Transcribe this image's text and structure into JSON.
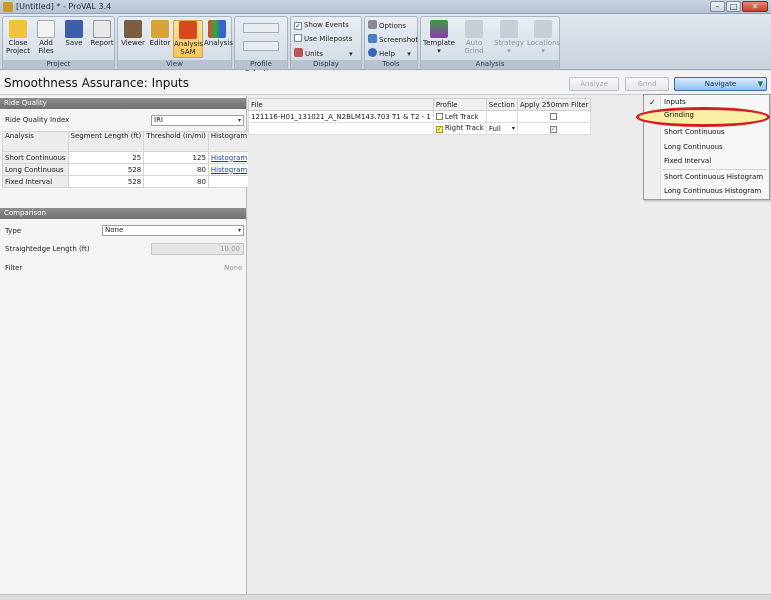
{
  "window": {
    "title": "[Untitled] * - ProVAL 3.4"
  },
  "ribbon": {
    "groups": {
      "project": {
        "label": "Project",
        "buttons": [
          "Close Project",
          "Add Files",
          "Save",
          "Report"
        ]
      },
      "view": {
        "label": "View",
        "buttons": [
          "Viewer",
          "Editor",
          "Analysis SAM",
          "Analysis"
        ]
      },
      "profile_selection": {
        "label": "Profile Selection"
      },
      "display": {
        "label": "Display",
        "items": [
          "Show Events",
          "Use Mileposts",
          "Units"
        ]
      },
      "tools": {
        "label": "Tools",
        "items": [
          "Options",
          "Screenshot",
          "Help"
        ]
      },
      "analysis": {
        "label": "Analysis",
        "buttons": [
          "Template",
          "Auto Grind",
          "Strategy",
          "Locations"
        ]
      }
    }
  },
  "header": {
    "title": "Smoothness Assurance: Inputs",
    "analyze_label": "Analyze",
    "grind_label": "Grind",
    "navigate_label": "Navigate"
  },
  "ride_quality": {
    "section_label": "Ride Quality",
    "index_label": "Ride Quality Index",
    "index_value": "IRI",
    "columns": [
      "Analysis",
      "Segment Length (ft)",
      "Threshold (in/mi)",
      "Histogram"
    ],
    "rows": [
      {
        "analysis": "Short Continuous",
        "segment": "25",
        "threshold": "125",
        "histogram": "Histogram"
      },
      {
        "analysis": "Long Continuous",
        "segment": "528",
        "threshold": "80",
        "histogram": "Histogram"
      },
      {
        "analysis": "Fixed Interval",
        "segment": "528",
        "threshold": "80",
        "histogram": ""
      }
    ]
  },
  "comparison": {
    "section_label": "Comparison",
    "type_label": "Type",
    "type_value": "None",
    "straightedge_label": "Straightedge Length (ft)",
    "straightedge_value": "10.00",
    "filter_label": "Filter",
    "filter_value": "None"
  },
  "files": {
    "columns": [
      "File",
      "Profile",
      "Section",
      "Apply 250mm Filter"
    ],
    "rows": [
      {
        "file": "121116-H01_131021_A_N2BLM143.703 T1 & T2 - 1",
        "profile": "Left Track",
        "profile_checked": false,
        "section": "",
        "filter_checked": false
      },
      {
        "file": "",
        "profile": "Right Track",
        "profile_checked": true,
        "section": "Full",
        "filter_checked": true
      }
    ]
  },
  "navigate_menu": {
    "items": [
      "Inputs",
      "Grinding",
      "Short Continuous",
      "Long Continuous",
      "Fixed Interval",
      "Short Continuous Histogram",
      "Long Continuous Histogram"
    ],
    "checked_item": "Inputs",
    "highlighted_item": "Grinding"
  },
  "colors": {
    "highlight_ring": "#d21f1f",
    "navigate_button": "#8fc1f0",
    "section_header": "#7a7a7a"
  }
}
